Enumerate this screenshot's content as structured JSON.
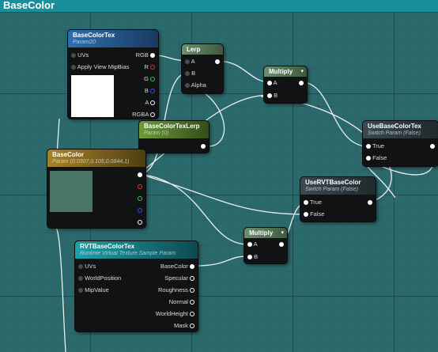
{
  "window": {
    "title": "BaseColor"
  },
  "colors": {
    "graph_bg": "#2b6a6c",
    "title_bar": "#1a8f9c"
  },
  "nodes": {
    "basecolortex": {
      "title": "BaseColorTex",
      "subtitle": "Param2D",
      "inputs": [
        "UVs",
        "Apply View MipBias"
      ],
      "outputs": [
        "RGB",
        "R",
        "G",
        "B",
        "A",
        "RGBA"
      ],
      "preview_color": "#ffffff"
    },
    "lerp": {
      "title": "Lerp",
      "inputs": [
        "A",
        "B",
        "Alpha"
      ]
    },
    "multiply1": {
      "title": "Multiply",
      "inputs": [
        "A",
        "B"
      ]
    },
    "basecolortexlerp": {
      "title": "BaseColorTexLerp",
      "subtitle": "Param (0)"
    },
    "usebasecolortex": {
      "title": "UseBaseColorTex",
      "subtitle": "Switch Param (False)",
      "inputs": [
        "True",
        "False"
      ]
    },
    "basecolor": {
      "title": "BaseColor",
      "subtitle": "Param (0.0307,0.105,0.0844,1)",
      "preview_color": "#4a7466"
    },
    "usertbasecolor": {
      "title": "UseRVTBaseColor",
      "subtitle": "Switch Param (False)",
      "inputs": [
        "True",
        "False"
      ]
    },
    "multiply2": {
      "title": "Multiply",
      "inputs": [
        "A",
        "B"
      ]
    },
    "rvtbasecolortex": {
      "title": "RVTBaseColorTex",
      "subtitle": "Runtime Virtual Texture Sample Param",
      "inputs": [
        "UVs",
        "WorldPosition",
        "MipValue"
      ],
      "outputs": [
        "BaseColor",
        "Specular",
        "Roughness",
        "Normal",
        "WorldHeight",
        "Mask"
      ]
    }
  }
}
